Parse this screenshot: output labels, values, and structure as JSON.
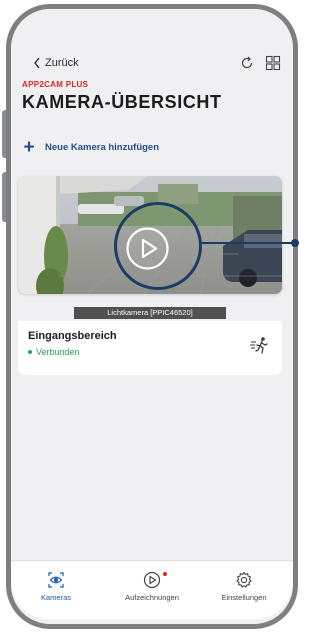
{
  "header": {
    "back_label": "Zurück",
    "brand": "APP2CAM PLUS",
    "title": "KAMERA-ÜBERSICHT",
    "refresh_icon": "refresh-icon",
    "grid_icon": "grid-view-icon"
  },
  "add_camera": {
    "label": "Neue Kamera hinzufügen",
    "icon": "plus-icon"
  },
  "camera": {
    "caption": "Lichtkamera [PPIC46520]",
    "name": "Eingangsbereich",
    "status": "Verbunden",
    "play_icon": "play-icon",
    "motion_icon": "motion-detection-icon"
  },
  "nav": {
    "items": [
      {
        "label": "Kameras",
        "icon": "camera-eye-icon",
        "active": true
      },
      {
        "label": "Aufzeichnungen",
        "icon": "play-circle-icon",
        "active": false
      },
      {
        "label": "Einstellungen",
        "icon": "gear-icon",
        "active": false
      }
    ]
  },
  "colors": {
    "accent": "#1e4e8c",
    "brand_red": "#d7281e",
    "status_green": "#2ea44f",
    "frame_gray": "#7d7f83",
    "highlight_navy": "#1b3c64"
  }
}
